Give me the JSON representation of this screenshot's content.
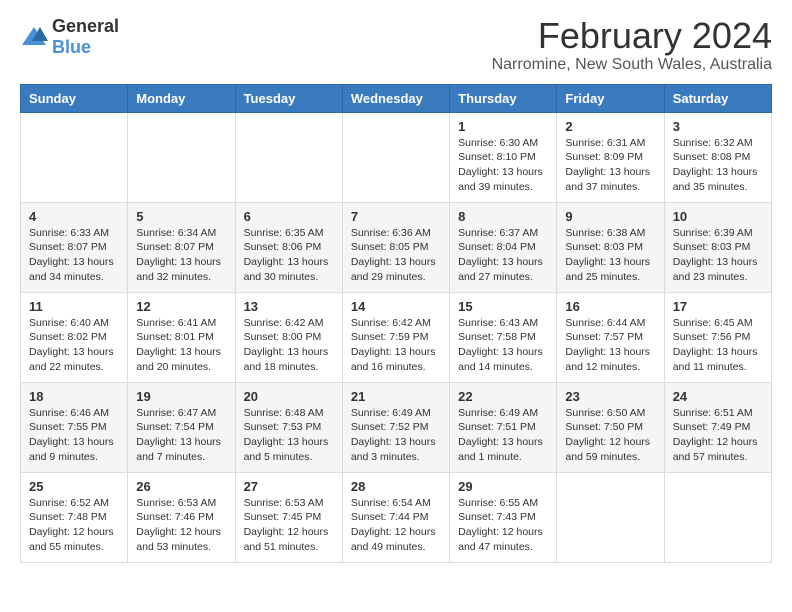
{
  "logo": {
    "general": "General",
    "blue": "Blue"
  },
  "title": "February 2024",
  "subtitle": "Narromine, New South Wales, Australia",
  "days_of_week": [
    "Sunday",
    "Monday",
    "Tuesday",
    "Wednesday",
    "Thursday",
    "Friday",
    "Saturday"
  ],
  "weeks": [
    [
      {
        "day": "",
        "detail": ""
      },
      {
        "day": "",
        "detail": ""
      },
      {
        "day": "",
        "detail": ""
      },
      {
        "day": "",
        "detail": ""
      },
      {
        "day": "1",
        "detail": "Sunrise: 6:30 AM\nSunset: 8:10 PM\nDaylight: 13 hours\nand 39 minutes."
      },
      {
        "day": "2",
        "detail": "Sunrise: 6:31 AM\nSunset: 8:09 PM\nDaylight: 13 hours\nand 37 minutes."
      },
      {
        "day": "3",
        "detail": "Sunrise: 6:32 AM\nSunset: 8:08 PM\nDaylight: 13 hours\nand 35 minutes."
      }
    ],
    [
      {
        "day": "4",
        "detail": "Sunrise: 6:33 AM\nSunset: 8:07 PM\nDaylight: 13 hours\nand 34 minutes."
      },
      {
        "day": "5",
        "detail": "Sunrise: 6:34 AM\nSunset: 8:07 PM\nDaylight: 13 hours\nand 32 minutes."
      },
      {
        "day": "6",
        "detail": "Sunrise: 6:35 AM\nSunset: 8:06 PM\nDaylight: 13 hours\nand 30 minutes."
      },
      {
        "day": "7",
        "detail": "Sunrise: 6:36 AM\nSunset: 8:05 PM\nDaylight: 13 hours\nand 29 minutes."
      },
      {
        "day": "8",
        "detail": "Sunrise: 6:37 AM\nSunset: 8:04 PM\nDaylight: 13 hours\nand 27 minutes."
      },
      {
        "day": "9",
        "detail": "Sunrise: 6:38 AM\nSunset: 8:03 PM\nDaylight: 13 hours\nand 25 minutes."
      },
      {
        "day": "10",
        "detail": "Sunrise: 6:39 AM\nSunset: 8:03 PM\nDaylight: 13 hours\nand 23 minutes."
      }
    ],
    [
      {
        "day": "11",
        "detail": "Sunrise: 6:40 AM\nSunset: 8:02 PM\nDaylight: 13 hours\nand 22 minutes."
      },
      {
        "day": "12",
        "detail": "Sunrise: 6:41 AM\nSunset: 8:01 PM\nDaylight: 13 hours\nand 20 minutes."
      },
      {
        "day": "13",
        "detail": "Sunrise: 6:42 AM\nSunset: 8:00 PM\nDaylight: 13 hours\nand 18 minutes."
      },
      {
        "day": "14",
        "detail": "Sunrise: 6:42 AM\nSunset: 7:59 PM\nDaylight: 13 hours\nand 16 minutes."
      },
      {
        "day": "15",
        "detail": "Sunrise: 6:43 AM\nSunset: 7:58 PM\nDaylight: 13 hours\nand 14 minutes."
      },
      {
        "day": "16",
        "detail": "Sunrise: 6:44 AM\nSunset: 7:57 PM\nDaylight: 13 hours\nand 12 minutes."
      },
      {
        "day": "17",
        "detail": "Sunrise: 6:45 AM\nSunset: 7:56 PM\nDaylight: 13 hours\nand 11 minutes."
      }
    ],
    [
      {
        "day": "18",
        "detail": "Sunrise: 6:46 AM\nSunset: 7:55 PM\nDaylight: 13 hours\nand 9 minutes."
      },
      {
        "day": "19",
        "detail": "Sunrise: 6:47 AM\nSunset: 7:54 PM\nDaylight: 13 hours\nand 7 minutes."
      },
      {
        "day": "20",
        "detail": "Sunrise: 6:48 AM\nSunset: 7:53 PM\nDaylight: 13 hours\nand 5 minutes."
      },
      {
        "day": "21",
        "detail": "Sunrise: 6:49 AM\nSunset: 7:52 PM\nDaylight: 13 hours\nand 3 minutes."
      },
      {
        "day": "22",
        "detail": "Sunrise: 6:49 AM\nSunset: 7:51 PM\nDaylight: 13 hours\nand 1 minute."
      },
      {
        "day": "23",
        "detail": "Sunrise: 6:50 AM\nSunset: 7:50 PM\nDaylight: 12 hours\nand 59 minutes."
      },
      {
        "day": "24",
        "detail": "Sunrise: 6:51 AM\nSunset: 7:49 PM\nDaylight: 12 hours\nand 57 minutes."
      }
    ],
    [
      {
        "day": "25",
        "detail": "Sunrise: 6:52 AM\nSunset: 7:48 PM\nDaylight: 12 hours\nand 55 minutes."
      },
      {
        "day": "26",
        "detail": "Sunrise: 6:53 AM\nSunset: 7:46 PM\nDaylight: 12 hours\nand 53 minutes."
      },
      {
        "day": "27",
        "detail": "Sunrise: 6:53 AM\nSunset: 7:45 PM\nDaylight: 12 hours\nand 51 minutes."
      },
      {
        "day": "28",
        "detail": "Sunrise: 6:54 AM\nSunset: 7:44 PM\nDaylight: 12 hours\nand 49 minutes."
      },
      {
        "day": "29",
        "detail": "Sunrise: 6:55 AM\nSunset: 7:43 PM\nDaylight: 12 hours\nand 47 minutes."
      },
      {
        "day": "",
        "detail": ""
      },
      {
        "day": "",
        "detail": ""
      }
    ]
  ]
}
